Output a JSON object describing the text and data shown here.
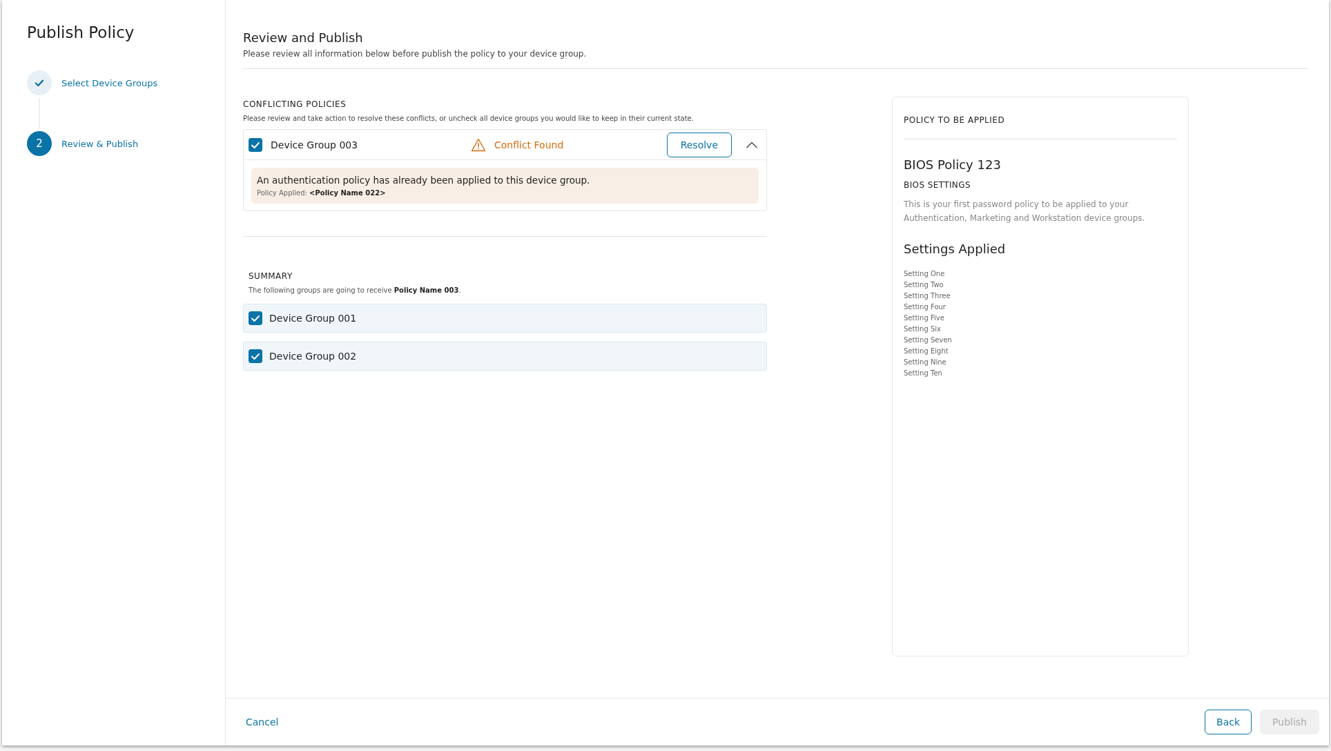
{
  "sidebar": {
    "title": "Publish Policy",
    "steps": [
      {
        "label": "Select Device Groups",
        "completed": true,
        "selected": false
      },
      {
        "label": "Review & Publish",
        "number": "2",
        "completed": false,
        "selected": true
      }
    ]
  },
  "header": {
    "title": "Review and Publish",
    "subtitle": "Please review all information below before publish the policy to your device group."
  },
  "conflicts": {
    "title": "CONFLICTING POLICIES",
    "description": "Please review and take action to resolve these conflicts, or uncheck all device groups you would like to keep in their current state.",
    "items": [
      {
        "group": "Device Group 003",
        "checked": true,
        "status": "Conflict Found",
        "action": "Resolve",
        "expanded": true,
        "message": "An authentication policy has already been applied to this device group.",
        "policy_label": "Policy Applied:",
        "policy_name": "<Policy Name 022>"
      }
    ]
  },
  "summary": {
    "title": "SUMMARY",
    "description": "The following groups are going to receive **Policy Name 003**.",
    "groups": [
      {
        "label": "Device Group 001",
        "checked": true
      },
      {
        "label": "Device Group 002",
        "checked": true
      }
    ]
  },
  "policy_panel": {
    "title": "POLICY TO BE APPLIED",
    "policy_name": "BIOS Policy 123",
    "category": "BIOS SETTINGS",
    "description": "This is your first password policy to be applied to your Authentication, Marketing and  Workstation device groups.",
    "settings_title": "Settings Applied",
    "settings": [
      "Setting One",
      "Setting Two",
      "Setting Three",
      "Setting Four",
      "Setting Five",
      "Setting Six",
      "Setting Seven",
      "Setting Eight",
      "Setting Nine",
      "Setting Ten"
    ]
  },
  "footer": {
    "cancel": "Cancel",
    "back": "Back",
    "publish": {
      "label": "Publish",
      "disabled": true
    }
  }
}
